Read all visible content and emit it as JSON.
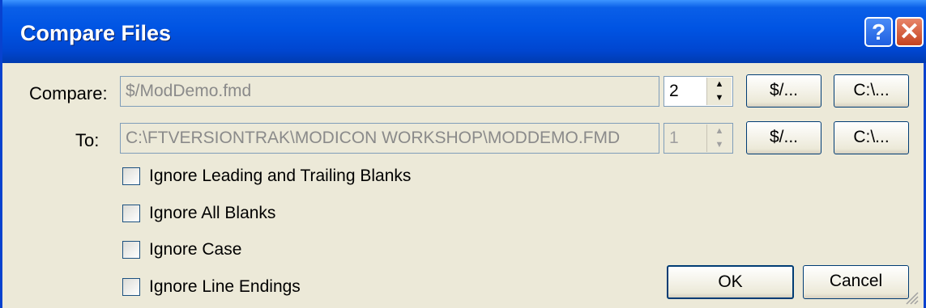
{
  "window": {
    "title": "Compare Files",
    "help": "?",
    "close": "✕"
  },
  "compare": {
    "label": "Compare:",
    "path": "$/ModDemo.fmd",
    "version": "2",
    "vss_button": "$/...",
    "local_button": "C:\\..."
  },
  "to": {
    "label": "To:",
    "path": "C:\\FTVERSIONTRAK\\MODICON WORKSHOP\\MODDEMO.FMD",
    "version": "1",
    "vss_button": "$/...",
    "local_button": "C:\\..."
  },
  "options": [
    {
      "label": "Ignore Leading and Trailing Blanks",
      "checked": false
    },
    {
      "label": "Ignore All Blanks",
      "checked": false
    },
    {
      "label": "Ignore Case",
      "checked": false
    },
    {
      "label": "Ignore Line Endings",
      "checked": false
    }
  ],
  "buttons": {
    "ok": "OK",
    "cancel": "Cancel"
  },
  "icons": {
    "spin_up": "spin-up-icon",
    "spin_down": "spin-down-icon",
    "help": "help-icon",
    "close": "close-icon"
  }
}
